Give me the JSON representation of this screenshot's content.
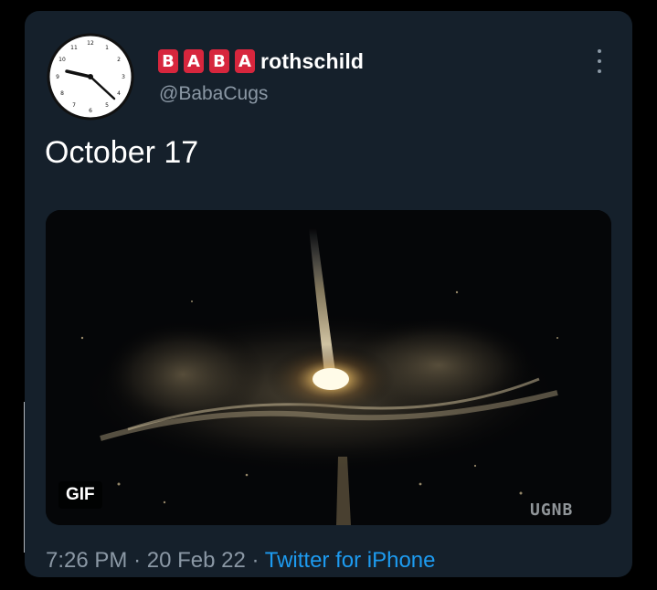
{
  "tweet": {
    "name_tiles": [
      "B",
      "A",
      "B",
      "A"
    ],
    "name_rest": "rothschild",
    "handle": "@BabaCugs",
    "text": "October 17",
    "media": {
      "badge": "GIF",
      "watermark": "UGNB"
    },
    "time": "7:26 PM",
    "sep1": "·",
    "date": "20 Feb 22",
    "sep2": "·",
    "source": "Twitter for iPhone"
  },
  "icons": {
    "avatar": "clock-icon",
    "more": "more-vertical-icon"
  },
  "colors": {
    "background": "#000000",
    "card": "#15202b",
    "tile": "#d7263d",
    "secondary_text": "#8b98a5",
    "link": "#1d9bf0"
  }
}
